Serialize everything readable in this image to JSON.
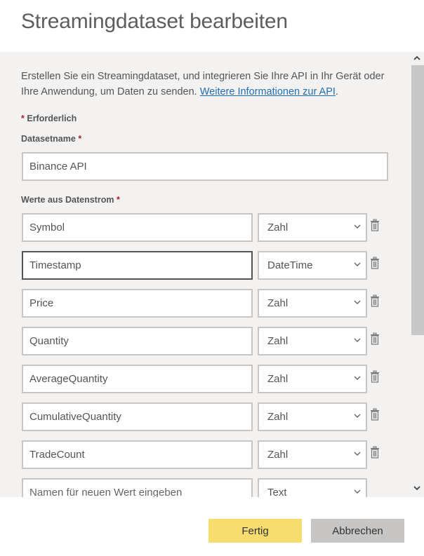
{
  "dialog": {
    "title": "Streamingdataset bearbeiten",
    "description_text": "Erstellen Sie ein Streamingdataset, und integrieren Sie Ihre API in Ihr Gerät oder Ihre Anwendung, um Daten zu senden. ",
    "description_link": "Weitere Informationen zur API",
    "description_end": ".",
    "required_marker": "*",
    "required_note": "Erforderlich"
  },
  "dataset_name": {
    "label": "Datasetname",
    "value": "Binance API"
  },
  "values_section": {
    "label": "Werte aus Datenstrom",
    "rows": [
      {
        "name": "Symbol",
        "type": "Zahl",
        "deletable": true,
        "focused": false
      },
      {
        "name": "Timestamp",
        "type": "DateTime",
        "deletable": true,
        "focused": true
      },
      {
        "name": "Price",
        "type": "Zahl",
        "deletable": true,
        "focused": false
      },
      {
        "name": "Quantity",
        "type": "Zahl",
        "deletable": true,
        "focused": false
      },
      {
        "name": "AverageQuantity",
        "type": "Zahl",
        "deletable": true,
        "focused": false
      },
      {
        "name": "CumulativeQuantity",
        "type": "Zahl",
        "deletable": true,
        "focused": false
      },
      {
        "name": "TradeCount",
        "type": "Zahl",
        "deletable": true,
        "focused": false
      }
    ],
    "new_row": {
      "placeholder": "Namen für neuen Wert eingeben",
      "type": "Text"
    }
  },
  "icons": {
    "delete": "trash-icon",
    "dropdown": "chevron-down-icon",
    "scroll_up": "chevron-up-icon",
    "scroll_down": "chevron-down-icon"
  },
  "footer": {
    "done_label": "Fertig",
    "cancel_label": "Abbrechen"
  },
  "colors": {
    "primary_button": "#f7dd6f",
    "secondary_button": "#c8c6c4",
    "link": "#1f6fb5",
    "required_star": "#a4262c",
    "panel_background": "#f3f2f1"
  }
}
